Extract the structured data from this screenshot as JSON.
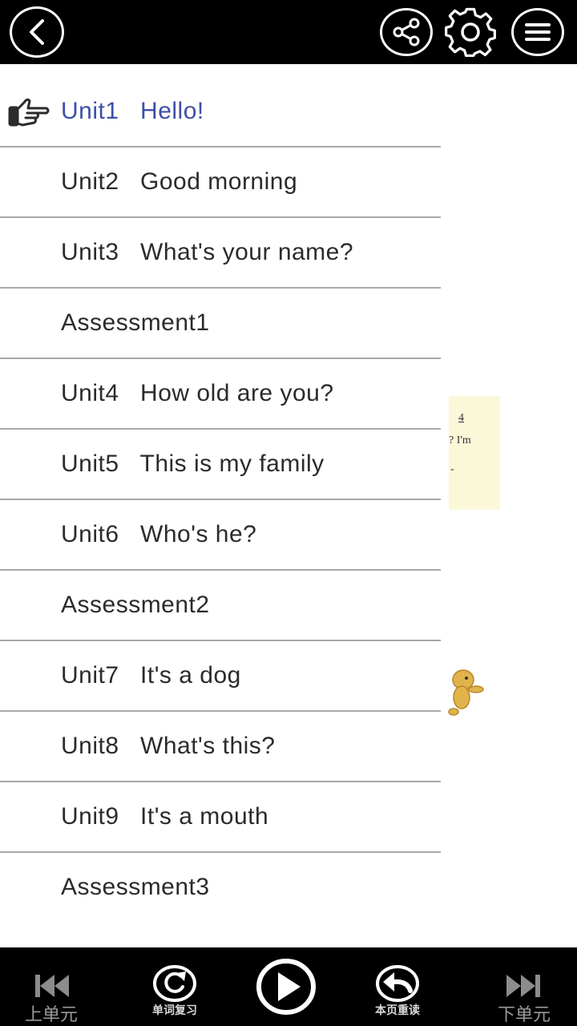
{
  "header": {
    "back_icon": "chevron-left-icon",
    "share_icon": "share-icon",
    "settings_icon": "gear-icon",
    "menu_icon": "hamburger-menu-icon"
  },
  "unit_list": {
    "active_index": 0,
    "active_color": "#3d4fa8",
    "pointer_icon": "hand-pointer-icon",
    "items": [
      {
        "label": "Unit1   Hello!"
      },
      {
        "label": "Unit2   Good morning"
      },
      {
        "label": "Unit3   What's your name?"
      },
      {
        "label": "Assessment1"
      },
      {
        "label": "Unit4   How old are you?"
      },
      {
        "label": "Unit5   This is my family"
      },
      {
        "label": "Unit6   Who's he?"
      },
      {
        "label": "Assessment2"
      },
      {
        "label": "Unit7   It's a dog"
      },
      {
        "label": "Unit8   What's this?"
      },
      {
        "label": "Unit9   It's a mouth"
      },
      {
        "label": "Assessment3"
      }
    ]
  },
  "background_page": {
    "snippet_lines": [
      "4",
      "? I'm",
      "-"
    ]
  },
  "footer": {
    "prev_unit": "上单元",
    "word_review": "单词复习",
    "play_icon": "play-icon",
    "reread_page": "本页重读",
    "next_unit": "下单元"
  }
}
